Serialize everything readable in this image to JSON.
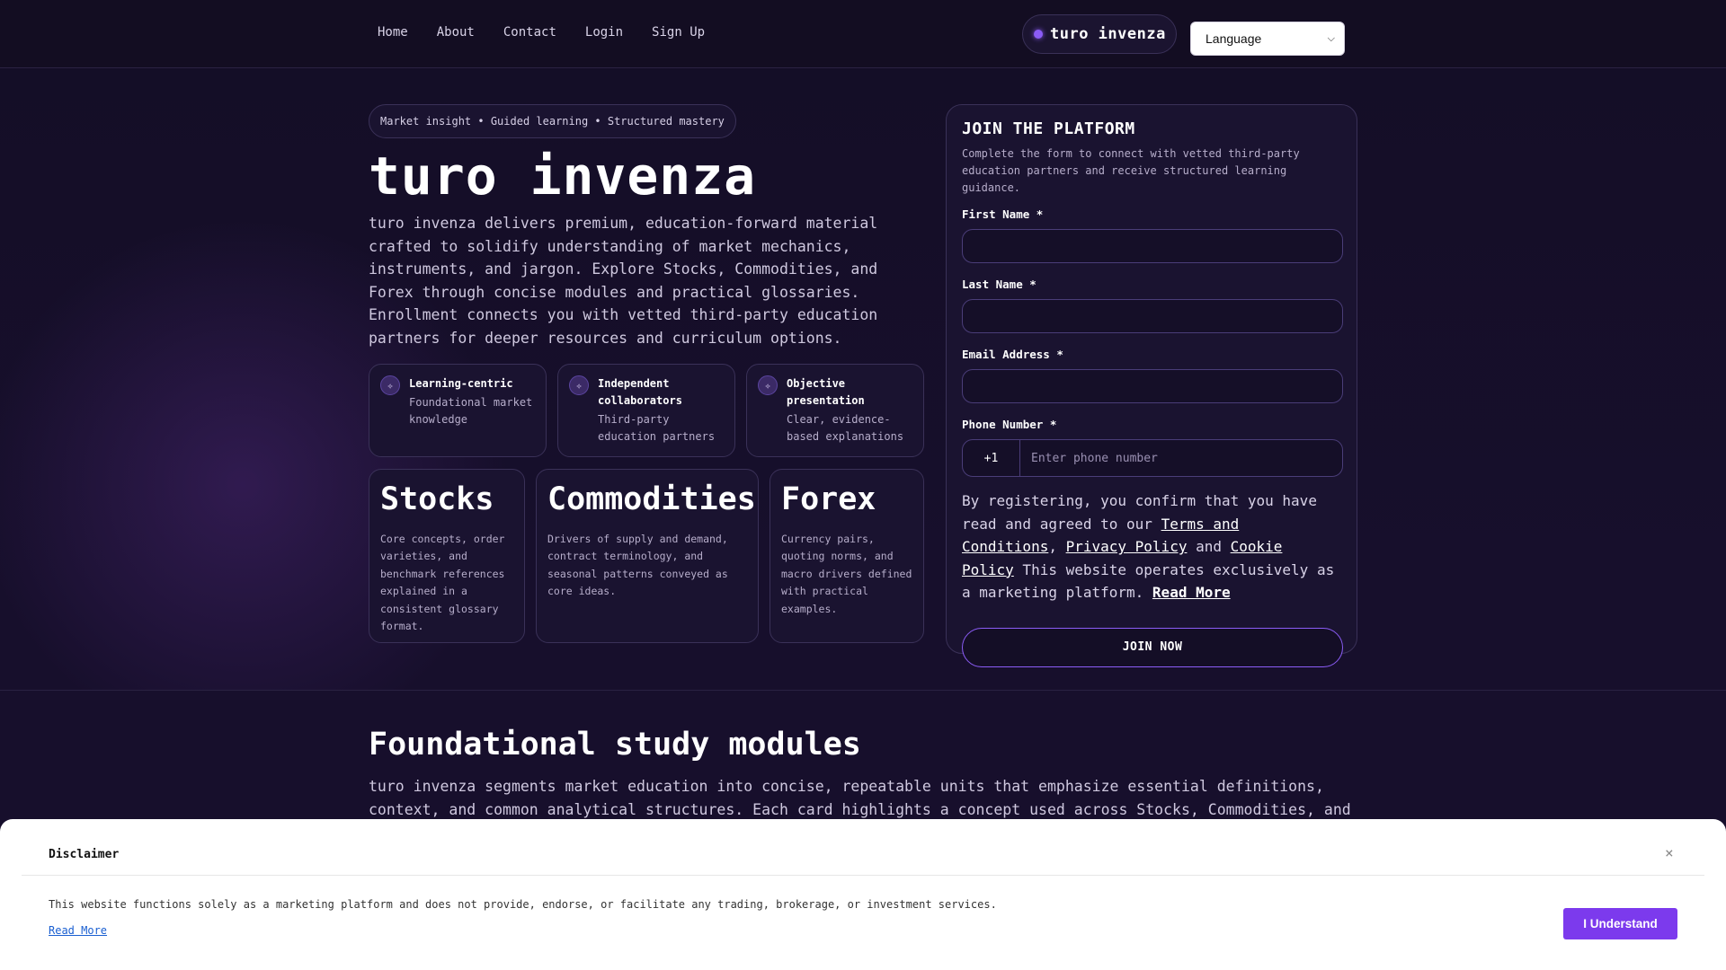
{
  "nav": {
    "links": [
      "Home",
      "About",
      "Contact",
      "Login",
      "Sign Up"
    ],
    "brand": "turo invenza",
    "language_select": "Language"
  },
  "hero": {
    "tagline": "Market insight • Guided learning • Structured mastery",
    "title": "turo invenza",
    "description": "turo invenza delivers premium, education-forward material crafted to solidify understanding of market mechanics, instruments, and jargon. Explore Stocks, Commodities, and Forex through concise modules and practical glossaries. Enrollment connects you with vetted third-party education partners for deeper resources and curriculum options.",
    "features": [
      {
        "title": "Learning-centric",
        "subtitle": "Foundational market knowledge",
        "icon": "sparkle-icon"
      },
      {
        "title": "Independent collaborators",
        "subtitle": "Third-party education partners",
        "icon": "sparkle-icon"
      },
      {
        "title": "Objective presentation",
        "subtitle": "Clear, evidence-based explanations",
        "icon": "sparkle-icon"
      }
    ],
    "categories": [
      {
        "title": "Stocks",
        "description": "Core concepts, order varieties, and benchmark references explained in a consistent glossary format."
      },
      {
        "title": "Commodities",
        "description": "Drivers of supply and demand, contract terminology, and seasonal patterns conveyed as core ideas."
      },
      {
        "title": "Forex",
        "description": "Currency pairs, quoting norms, and macro drivers defined with practical examples."
      }
    ]
  },
  "form": {
    "title": "JOIN THE PLATFORM",
    "subtitle": "Complete the form to connect with vetted third-party education partners and receive structured learning guidance.",
    "first_name_label": "First Name *",
    "last_name_label": "Last Name *",
    "email_label": "Email Address *",
    "phone_label": "Phone Number *",
    "phone_code": "+1",
    "phone_placeholder": "Enter phone number",
    "consent_prefix": "By registering, you confirm that you have read and agreed to our ",
    "terms_link": "Terms and Conditions",
    "comma": ", ",
    "privacy_link": "Privacy Policy",
    "and": " and ",
    "cookie_link": "Cookie Policy",
    "consent_suffix": " This website operates exclusively as a marketing platform. ",
    "read_more_link": "Read More",
    "submit_label": "JOIN NOW"
  },
  "modules": {
    "title": "Foundational study modules",
    "description": "turo invenza segments market education into concise, repeatable units that emphasize essential definitions, context, and common analytical structures. Each card highlights a concept used across Stocks, Commodities, and"
  },
  "disclaimer": {
    "title": "Disclaimer",
    "close": "×",
    "text": "This website functions solely as a marketing platform and does not provide, endorse, or facilitate any trading, brokerage, or investment services.",
    "read_more": "Read More",
    "button": "I Understand"
  },
  "colors": {
    "accent": "#8b5cf6",
    "button_purple": "#7c3aed",
    "background": "#130d24"
  }
}
